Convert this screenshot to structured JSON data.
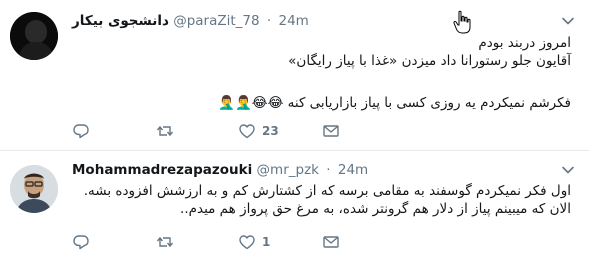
{
  "tweets": [
    {
      "author_name": "دانشجوی بیکار",
      "handle": "@paraZit_78",
      "separator": "·",
      "time": "24m",
      "lines": [
        "امروز دربند بودم",
        "آقایون جلو رستورانا داد میزدن «غذا با پیاز رایگان»",
        "فکرشم نمیکردم یه روزی کسی با پیاز بازاریابی کنه 😂😂🤦‍♂️🤦‍♂️"
      ],
      "reply_count": "",
      "retweet_count": "",
      "like_count": "23"
    },
    {
      "author_name": "Mohammadrezapazouki",
      "handle": "@mr_pzk",
      "separator": "·",
      "time": "24m",
      "lines": [
        "اول فکر نمیکردم گوسفند به مقامی برسه که از کشتارش کم و به ارزشش افزوده بشه. الان که میبینم پیاز از دلار هم گرونتر شده، به مرغ حق پرواز هم میدم.."
      ],
      "reply_count": "",
      "retweet_count": "",
      "like_count": "1"
    }
  ],
  "icons": {
    "reply": "reply-icon",
    "retweet": "retweet-icon",
    "like": "heart-icon",
    "dm": "envelope-icon",
    "caret": "chevron-down-icon"
  },
  "colors": {
    "text": "#14171a",
    "muted": "#657786",
    "divider": "#e6ecf0"
  }
}
